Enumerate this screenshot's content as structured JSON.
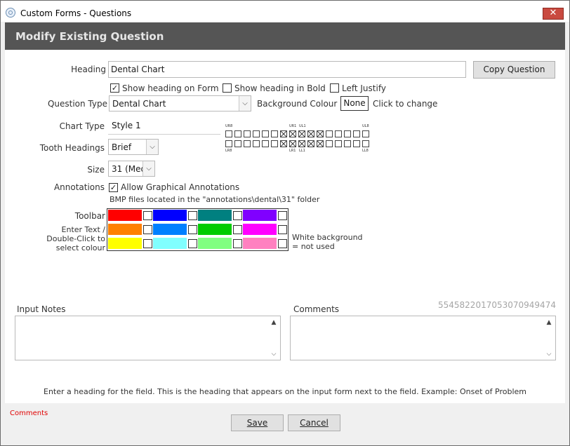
{
  "window": {
    "title": "Custom Forms - Questions",
    "close_glyph": "✕"
  },
  "banner": {
    "title": "Modify Existing Question"
  },
  "form": {
    "heading_label": "Heading",
    "heading_value": "Dental Chart",
    "copy_button": "Copy Question",
    "show_heading_on_form": {
      "label": "Show heading on Form",
      "checked": true
    },
    "show_heading_bold": {
      "label": "Show heading in Bold",
      "checked": false
    },
    "left_justify": {
      "label": "Left Justify",
      "checked": false
    },
    "question_type_label": "Question Type",
    "question_type_value": "Dental Chart",
    "background_colour_label": "Background Colour",
    "background_colour_value": "None",
    "click_to_change": "Click to change",
    "chart_type_label": "Chart Type",
    "chart_type_value": "Style 1",
    "tooth_headings_label": "Tooth Headings",
    "tooth_headings_value": "Brief",
    "size_label": "Size",
    "size_value": "31 (Med",
    "annotations_label": "Annotations",
    "allow_annotations": {
      "label": "Allow Graphical Annotations",
      "checked": true
    },
    "bmp_note": "BMP files located in the \"annotations\\dental\\31\" folder",
    "toolbar_label": "Toolbar",
    "enter_text_label": "Enter Text /",
    "double_click_label": "Double-Click to",
    "select_colour_label": "select colour",
    "white_bg_note_1": "White background",
    "white_bg_note_2": "= not used"
  },
  "dental_chart": {
    "upper_left_label": "UR8",
    "upper_mid_left": "UR1",
    "upper_mid_right": "UL1",
    "upper_right_label": "UL8",
    "lower_left_label": "LR8",
    "lower_mid_left": "LR1",
    "lower_mid_right": "LL1",
    "lower_right_label": "LL8",
    "upper_marks": [
      0,
      0,
      0,
      0,
      0,
      0,
      1,
      1,
      1,
      1,
      1,
      0,
      0,
      0,
      0,
      0
    ],
    "lower_marks": [
      0,
      0,
      0,
      0,
      0,
      0,
      1,
      1,
      1,
      1,
      1,
      0,
      0,
      0,
      0,
      0
    ]
  },
  "palette": {
    "rows": [
      [
        "#ff0000",
        "#0000ff",
        "#008080",
        "#8000ff"
      ],
      [
        "#ff8000",
        "#0080ff",
        "#00cc00",
        "#ff00ff"
      ],
      [
        "#ffff00",
        "#80ffff",
        "#80ff80",
        "#ff80c0"
      ]
    ]
  },
  "input_notes": {
    "label": "Input Notes"
  },
  "comments": {
    "label": "Comments",
    "id_text": "5545822017053070949474"
  },
  "hint": "Enter a heading for the field. This is the heading that appears on the input form next to the field. Example: Onset of Problem",
  "footer": {
    "comments_link": "Comments",
    "save_button": "Save",
    "cancel_button": "Cancel"
  }
}
